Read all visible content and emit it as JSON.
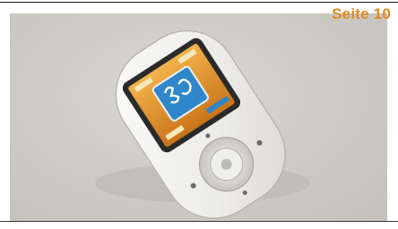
{
  "caption": {
    "page_label": "Seite 10"
  },
  "colors": {
    "label": "#e08a22",
    "background": "#cfccc7",
    "device_body": "#f4f3f1",
    "screen_bg": "#d98a2a",
    "screen_panel": "#2f86c9"
  },
  "device": {
    "icon": "display-symbol-icon"
  }
}
